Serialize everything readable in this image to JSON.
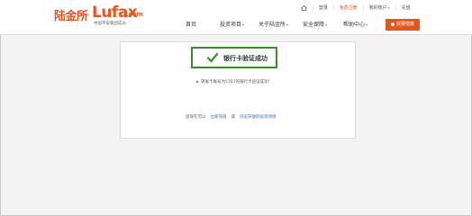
{
  "logo": {
    "cn": "陆金所",
    "en": "Lufax",
    "com": ".com",
    "tagline": "中国平安集团成员"
  },
  "topbar": {
    "icon": "home-icon",
    "login": "登录",
    "register": "免费注册",
    "account": "我的账户",
    "recharge": "充值"
  },
  "nav": {
    "items": [
      {
        "label": "首页",
        "dropdown": false
      },
      {
        "label": "投资项目",
        "dropdown": true
      },
      {
        "label": "关于陆金所",
        "dropdown": true
      },
      {
        "label": "安全保障",
        "dropdown": true
      },
      {
        "label": "帮助中心",
        "dropdown": true
      }
    ],
    "cta": "我要借款"
  },
  "panel": {
    "success_text": "银行卡验证成功",
    "success_color": "#3a8a2e",
    "info_text": "转账卡尾号为5767的银行卡验证成功！",
    "prefix": "您现在可以",
    "link1": "立即充值",
    "or": "或",
    "link2": "浏览开放的投资项目"
  },
  "colors": {
    "brand": "#e8541e",
    "link": "#2b6bb5"
  }
}
